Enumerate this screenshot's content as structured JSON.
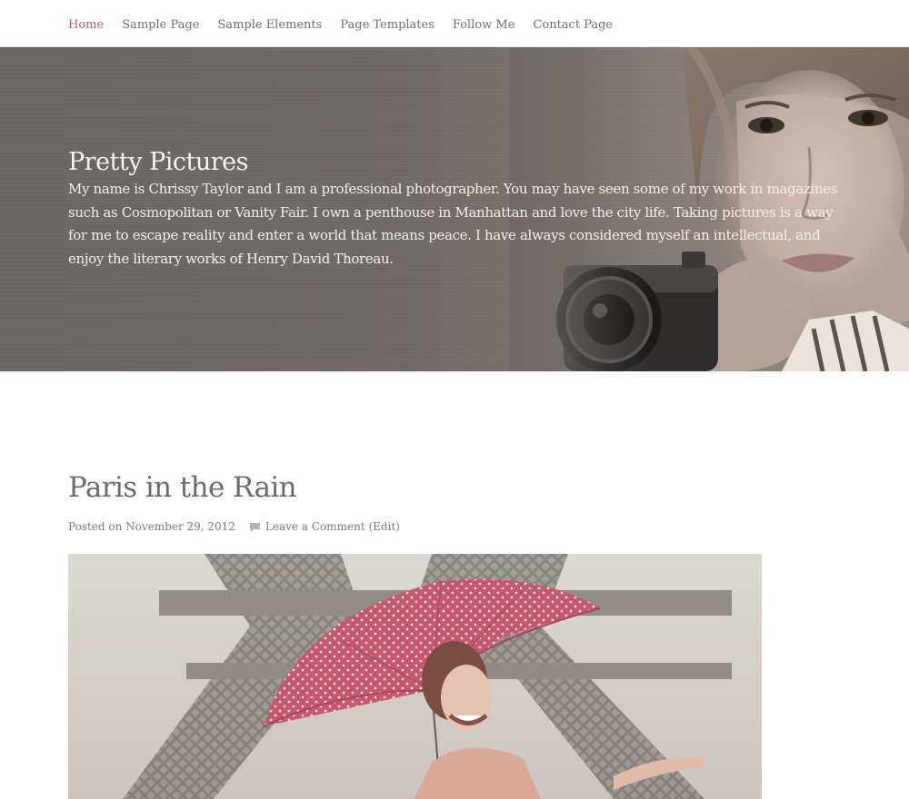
{
  "nav": {
    "items": [
      {
        "label": "Home",
        "active": true
      },
      {
        "label": "Sample Page"
      },
      {
        "label": "Sample Elements"
      },
      {
        "label": "Page Templates"
      },
      {
        "label": "Follow Me"
      },
      {
        "label": "Contact Page"
      }
    ]
  },
  "hero": {
    "title": "Pretty Pictures",
    "description": "My name is Chrissy Taylor and I am a professional photographer. You may have seen some of my work in magazines such as Cosmopolitan or Vanity Fair. I own a penthouse in Manhattan and love the city life. Taking pictures is a way for me to escape reality and enter a world that means peace. I have always considered myself an intellectual, and enjoy the literary works of Henry David Thoreau."
  },
  "post": {
    "title": "Paris in the Rain",
    "posted_on_label": "Posted on",
    "date": "November 29, 2012",
    "comment_link": "Leave a Comment",
    "edit_link": "(Edit)",
    "comment_icon": "comment-icon"
  },
  "colors": {
    "accent": "#b65d78",
    "nav_text": "#707070",
    "hero_bg": "#6f6a67",
    "umbrella": "#c9566e"
  }
}
